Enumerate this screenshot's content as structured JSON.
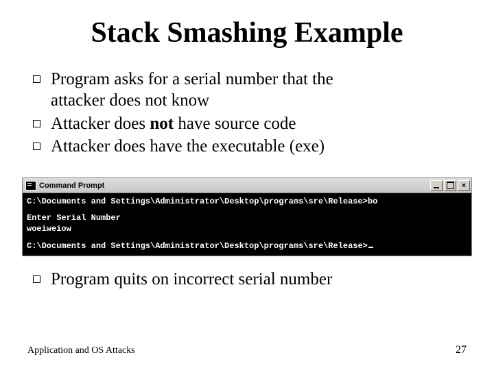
{
  "title": "Stack Smashing Example",
  "bullets": {
    "b1a": "Program asks for a serial number that the",
    "b1b": "attacker does not know",
    "b2_pre": "Attacker does ",
    "b2_bold": "not",
    "b2_post": " have source code",
    "b3": "Attacker does have the executable (exe)",
    "b4": "Program quits on incorrect serial number"
  },
  "cmd": {
    "titlebar": "Command Prompt",
    "line1": "C:\\Documents and Settings\\Administrator\\Desktop\\programs\\sre\\Release>bo",
    "line2": "Enter Serial Number",
    "line3": "woeiweiow",
    "line4": "C:\\Documents and Settings\\Administrator\\Desktop\\programs\\sre\\Release>"
  },
  "footer": {
    "left": "Application and OS Attacks",
    "pagenum": "27"
  }
}
